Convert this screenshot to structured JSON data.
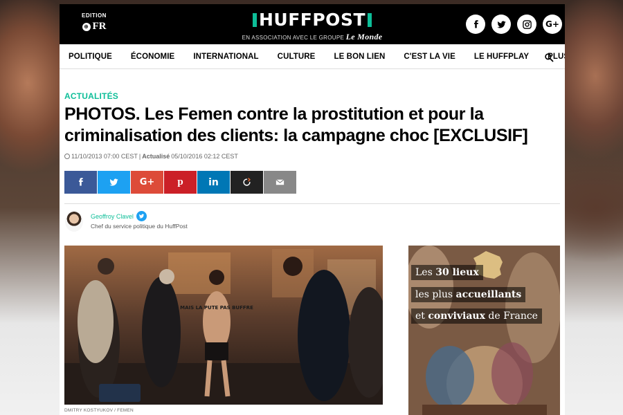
{
  "header": {
    "edition_label": "EDITION",
    "edition_value": "FR",
    "brand_name": "HUFFPOST",
    "brand_sub": "EN ASSOCIATION AVEC LE GROUPE",
    "partner": "Le Monde",
    "socials": [
      "facebook-icon",
      "twitter-icon",
      "instagram-icon",
      "google-plus-icon"
    ]
  },
  "nav": {
    "items": [
      "POLITIQUE",
      "ÉCONOMIE",
      "INTERNATIONAL",
      "CULTURE",
      "LE BON LIEN",
      "C'EST LA VIE",
      "LE HUFFPLAY",
      "PLUS"
    ]
  },
  "article": {
    "kicker": "ACTUALITÉS",
    "headline": "PHOTOS. Les Femen contre la prostitution et pour la criminalisation des clients: la campagne choc [EXCLUSIF]",
    "published": "11/10/2013 07:00 CEST",
    "separator": "|",
    "updated_label": "Actualisé",
    "updated": "05/10/2016 02:12 CEST",
    "author_name": "Geoffroy Clavel",
    "author_role": "Chef du service politique du HuffPost",
    "photo_credit": "DMITRY KOSTYUKOV / FEMEN",
    "photo_body_text": "MAIS LA PUTE PAS BUFFRE"
  },
  "share_buttons": [
    {
      "name": "facebook",
      "color": "#3b5998"
    },
    {
      "name": "twitter",
      "color": "#1da1f2"
    },
    {
      "name": "google-plus",
      "color": "#dd4b39"
    },
    {
      "name": "pinterest",
      "color": "#cb2027"
    },
    {
      "name": "linkedin",
      "color": "#0077b5"
    },
    {
      "name": "refresh",
      "color": "#222222"
    },
    {
      "name": "email",
      "color": "#888888"
    }
  ],
  "ad": {
    "line1_pre": "Les",
    "line1_bold": "30 lieux",
    "line2_pre": "les plus",
    "line2_bold": "accueillants",
    "line3_pre": "et",
    "line3_bold": "conviviaux",
    "line3_post": "de France"
  },
  "colors": {
    "accent": "#0dbe98",
    "topbar": "#000000"
  }
}
